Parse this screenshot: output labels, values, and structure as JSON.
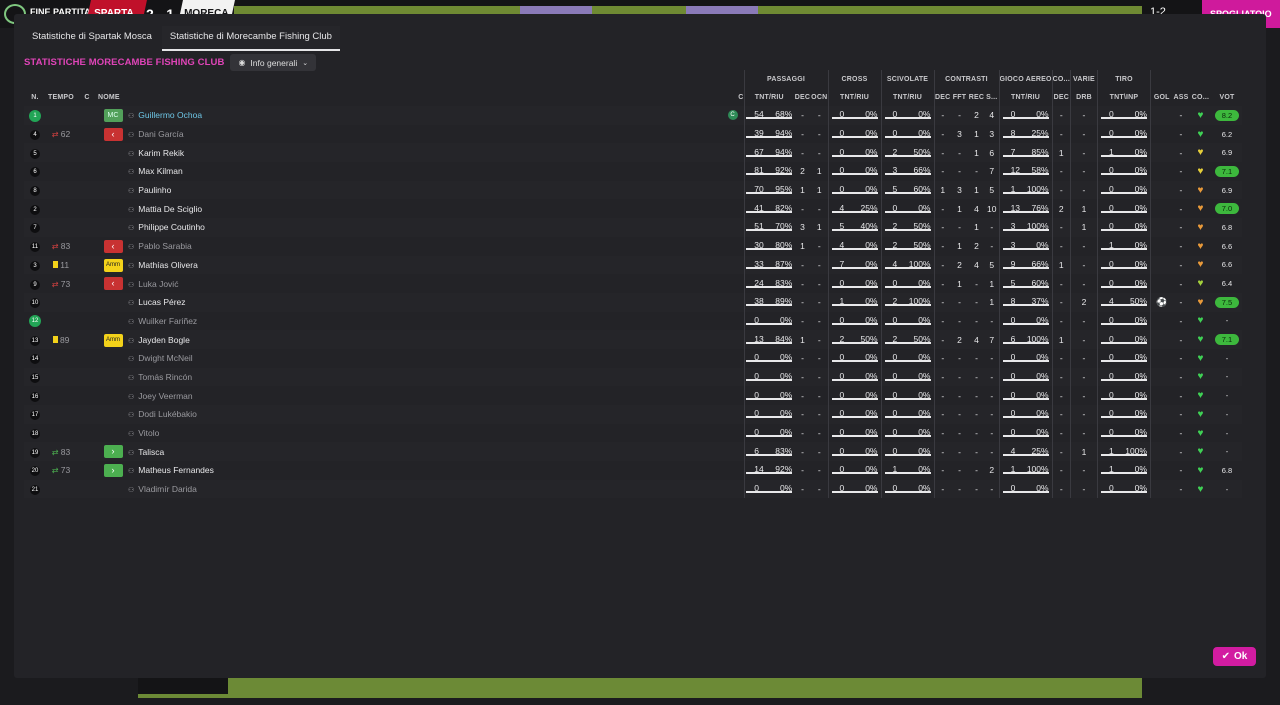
{
  "background": {
    "control": "FINE PARTITA",
    "teamA": "SPARTA",
    "score": "2 - 1",
    "teamB": "MORECA",
    "score2": "1-2",
    "pink_label": "SPOGLIATOIO"
  },
  "tabs": [
    {
      "label": "Statistiche di Spartak Mosca",
      "active": false
    },
    {
      "label": "Statistiche di Morecambe Fishing Club",
      "active": true
    }
  ],
  "club_title": "STATISTICHE MORECAMBE FISHING CLUB",
  "dropdown": {
    "label": "Info generali",
    "icon": "eye-icon"
  },
  "ok_label": "Ok",
  "groups": [
    "PASSAGGI",
    "CROSS",
    "SCIVOLATE",
    "CONTRASTI",
    "GIOCO AEREO",
    "CO...",
    "VARIE",
    "TIRO"
  ],
  "columns": [
    "N.",
    "TEMPO",
    "C",
    "NOME",
    "C",
    "TNT/RIU",
    "DEC",
    "OCN",
    "TNT/RIU",
    "TNT/RIU",
    "DEC",
    "FFT",
    "REC",
    "S...",
    "TNT/RIU",
    "DEC",
    "DRB",
    "TNT\\INP",
    "GOL",
    "ASS",
    "CO...",
    "VOT"
  ],
  "colors": {
    "accent": "#d21ca1",
    "title": "#e044b8",
    "highlight": "#6ec6e6"
  },
  "players": [
    {
      "n": "1",
      "tempo_icon": "",
      "tempo": "",
      "pos": "MC",
      "pos_type": "mc",
      "name": "Guillermo Ochoa",
      "name_style": "hl",
      "cap": "C",
      "pass": [
        "54",
        "68%"
      ],
      "dec": "-",
      "ocn": "-",
      "cross": [
        "0",
        "0%"
      ],
      "scv": [
        "0",
        "0%"
      ],
      "c_dec": "-",
      "fft": "-",
      "rec": "2",
      "s": "4",
      "aer": [
        "0",
        "0%"
      ],
      "co": "-",
      "drb": "-",
      "tiro": [
        "0",
        "0%"
      ],
      "gol": "",
      "ass": "-",
      "heart": "green",
      "vot": "8.2",
      "vot_style": "green",
      "n_green": true
    },
    {
      "n": "4",
      "tempo_icon": "sub",
      "tempo": "62",
      "pos": "‹",
      "pos_type": "sub",
      "name": "Dani García",
      "name_style": "grey",
      "cap": "",
      "pass": [
        "39",
        "94%"
      ],
      "dec": "-",
      "ocn": "-",
      "cross": [
        "0",
        "0%"
      ],
      "scv": [
        "0",
        "0%"
      ],
      "c_dec": "-",
      "fft": "3",
      "rec": "1",
      "s": "3",
      "aer": [
        "8",
        "25%"
      ],
      "co": "-",
      "drb": "-",
      "tiro": [
        "0",
        "0%"
      ],
      "gol": "",
      "ass": "-",
      "heart": "green",
      "vot": "6.2",
      "vot_style": "none"
    },
    {
      "n": "5",
      "tempo_icon": "",
      "tempo": "",
      "pos": "",
      "pos_type": "",
      "name": "Karim Rekik",
      "name_style": "",
      "cap": "",
      "pass": [
        "67",
        "94%"
      ],
      "dec": "-",
      "ocn": "-",
      "cross": [
        "0",
        "0%"
      ],
      "scv": [
        "2",
        "50%"
      ],
      "c_dec": "-",
      "fft": "-",
      "rec": "1",
      "s": "6",
      "aer": [
        "7",
        "85%"
      ],
      "co": "1",
      "drb": "-",
      "tiro": [
        "1",
        "0%"
      ],
      "gol": "",
      "ass": "-",
      "heart": "yellow",
      "vot": "6.9",
      "vot_style": "none"
    },
    {
      "n": "6",
      "tempo_icon": "",
      "tempo": "",
      "pos": "",
      "pos_type": "",
      "name": "Max Kilman",
      "name_style": "",
      "cap": "",
      "pass": [
        "81",
        "92%"
      ],
      "dec": "2",
      "ocn": "1",
      "cross": [
        "0",
        "0%"
      ],
      "scv": [
        "3",
        "66%"
      ],
      "c_dec": "-",
      "fft": "-",
      "rec": "-",
      "s": "7",
      "aer": [
        "12",
        "58%"
      ],
      "co": "-",
      "drb": "-",
      "tiro": [
        "0",
        "0%"
      ],
      "gol": "",
      "ass": "-",
      "heart": "yellow",
      "vot": "7.1",
      "vot_style": "green"
    },
    {
      "n": "8",
      "tempo_icon": "",
      "tempo": "",
      "pos": "",
      "pos_type": "",
      "name": "Paulinho",
      "name_style": "",
      "cap": "",
      "pass": [
        "70",
        "95%"
      ],
      "dec": "1",
      "ocn": "1",
      "cross": [
        "0",
        "0%"
      ],
      "scv": [
        "5",
        "60%"
      ],
      "c_dec": "1",
      "fft": "3",
      "rec": "1",
      "s": "5",
      "aer": [
        "1",
        "100%"
      ],
      "co": "-",
      "drb": "-",
      "tiro": [
        "0",
        "0%"
      ],
      "gol": "",
      "ass": "-",
      "heart": "orange",
      "vot": "6.9",
      "vot_style": "none"
    },
    {
      "n": "2",
      "tempo_icon": "",
      "tempo": "",
      "pos": "",
      "pos_type": "",
      "name": "Mattia De Sciglio",
      "name_style": "",
      "cap": "",
      "pass": [
        "41",
        "82%"
      ],
      "dec": "-",
      "ocn": "-",
      "cross": [
        "4",
        "25%"
      ],
      "scv": [
        "0",
        "0%"
      ],
      "c_dec": "-",
      "fft": "1",
      "rec": "4",
      "s": "10",
      "aer": [
        "13",
        "76%"
      ],
      "co": "2",
      "drb": "1",
      "tiro": [
        "0",
        "0%"
      ],
      "gol": "",
      "ass": "-",
      "heart": "orange",
      "vot": "7.0",
      "vot_style": "green"
    },
    {
      "n": "7",
      "tempo_icon": "",
      "tempo": "",
      "pos": "",
      "pos_type": "",
      "name": "Philippe Coutinho",
      "name_style": "",
      "cap": "",
      "pass": [
        "51",
        "70%"
      ],
      "dec": "3",
      "ocn": "1",
      "cross": [
        "5",
        "40%"
      ],
      "scv": [
        "2",
        "50%"
      ],
      "c_dec": "-",
      "fft": "-",
      "rec": "1",
      "s": "-",
      "aer": [
        "3",
        "100%"
      ],
      "co": "-",
      "drb": "1",
      "tiro": [
        "0",
        "0%"
      ],
      "gol": "",
      "ass": "-",
      "heart": "orange",
      "vot": "6.8",
      "vot_style": "none"
    },
    {
      "n": "11",
      "tempo_icon": "sub",
      "tempo": "83",
      "pos": "‹",
      "pos_type": "sub",
      "name": "Pablo Sarabia",
      "name_style": "grey",
      "cap": "",
      "pass": [
        "30",
        "80%"
      ],
      "dec": "1",
      "ocn": "-",
      "cross": [
        "4",
        "0%"
      ],
      "scv": [
        "2",
        "50%"
      ],
      "c_dec": "-",
      "fft": "1",
      "rec": "2",
      "s": "-",
      "aer": [
        "3",
        "0%"
      ],
      "co": "-",
      "drb": "-",
      "tiro": [
        "1",
        "0%"
      ],
      "gol": "",
      "ass": "-",
      "heart": "orange",
      "vot": "6.6",
      "vot_style": "none"
    },
    {
      "n": "3",
      "tempo_icon": "yellow",
      "tempo": "11",
      "pos": "Amm",
      "pos_type": "amm",
      "name": "Mathías Olivera",
      "name_style": "",
      "cap": "",
      "pass": [
        "33",
        "87%"
      ],
      "dec": "-",
      "ocn": "-",
      "cross": [
        "7",
        "0%"
      ],
      "scv": [
        "4",
        "100%"
      ],
      "c_dec": "-",
      "fft": "2",
      "rec": "4",
      "s": "5",
      "aer": [
        "9",
        "66%"
      ],
      "co": "1",
      "drb": "-",
      "tiro": [
        "0",
        "0%"
      ],
      "gol": "",
      "ass": "-",
      "heart": "orange",
      "vot": "6.6",
      "vot_style": "none"
    },
    {
      "n": "9",
      "tempo_icon": "sub",
      "tempo": "73",
      "pos": "‹",
      "pos_type": "sub",
      "name": "Luka Jović",
      "name_style": "grey",
      "cap": "",
      "pass": [
        "24",
        "83%"
      ],
      "dec": "-",
      "ocn": "-",
      "cross": [
        "0",
        "0%"
      ],
      "scv": [
        "0",
        "0%"
      ],
      "c_dec": "-",
      "fft": "1",
      "rec": "-",
      "s": "1",
      "aer": [
        "5",
        "60%"
      ],
      "co": "-",
      "drb": "-",
      "tiro": [
        "0",
        "0%"
      ],
      "gol": "",
      "ass": "-",
      "heart": "yellowgreen",
      "vot": "6.4",
      "vot_style": "none"
    },
    {
      "n": "10",
      "tempo_icon": "",
      "tempo": "",
      "pos": "",
      "pos_type": "",
      "name": "Lucas Pérez",
      "name_style": "",
      "cap": "",
      "pass": [
        "38",
        "89%"
      ],
      "dec": "-",
      "ocn": "-",
      "cross": [
        "1",
        "0%"
      ],
      "scv": [
        "2",
        "100%"
      ],
      "c_dec": "-",
      "fft": "-",
      "rec": "-",
      "s": "1",
      "aer": [
        "8",
        "37%"
      ],
      "co": "-",
      "drb": "2",
      "tiro": [
        "4",
        "50%"
      ],
      "gol": "ball",
      "ass": "-",
      "heart": "orange",
      "vot": "7.5",
      "vot_style": "green"
    },
    {
      "n": "12",
      "tempo_icon": "",
      "tempo": "",
      "pos": "",
      "pos_type": "",
      "name": "Wuilker Fariñez",
      "name_style": "grey",
      "cap": "",
      "pass": [
        "0",
        "0%"
      ],
      "dec": "-",
      "ocn": "-",
      "cross": [
        "0",
        "0%"
      ],
      "scv": [
        "0",
        "0%"
      ],
      "c_dec": "-",
      "fft": "-",
      "rec": "-",
      "s": "-",
      "aer": [
        "0",
        "0%"
      ],
      "co": "-",
      "drb": "-",
      "tiro": [
        "0",
        "0%"
      ],
      "gol": "",
      "ass": "-",
      "heart": "green",
      "vot": "-",
      "vot_style": "none",
      "n_green": true
    },
    {
      "n": "13",
      "tempo_icon": "yellow",
      "tempo": "89",
      "pos": "Amm",
      "pos_type": "amm",
      "name": "Jayden Bogle",
      "name_style": "",
      "cap": "",
      "pass": [
        "13",
        "84%"
      ],
      "dec": "1",
      "ocn": "-",
      "cross": [
        "2",
        "50%"
      ],
      "scv": [
        "2",
        "50%"
      ],
      "c_dec": "-",
      "fft": "2",
      "rec": "4",
      "s": "7",
      "aer": [
        "6",
        "100%"
      ],
      "co": "1",
      "drb": "-",
      "tiro": [
        "0",
        "0%"
      ],
      "gol": "",
      "ass": "-",
      "heart": "green",
      "vot": "7.1",
      "vot_style": "green"
    },
    {
      "n": "14",
      "tempo_icon": "",
      "tempo": "",
      "pos": "",
      "pos_type": "",
      "name": "Dwight McNeil",
      "name_style": "grey",
      "cap": "",
      "pass": [
        "0",
        "0%"
      ],
      "dec": "-",
      "ocn": "-",
      "cross": [
        "0",
        "0%"
      ],
      "scv": [
        "0",
        "0%"
      ],
      "c_dec": "-",
      "fft": "-",
      "rec": "-",
      "s": "-",
      "aer": [
        "0",
        "0%"
      ],
      "co": "-",
      "drb": "-",
      "tiro": [
        "0",
        "0%"
      ],
      "gol": "",
      "ass": "-",
      "heart": "green",
      "vot": "-",
      "vot_style": "none"
    },
    {
      "n": "15",
      "tempo_icon": "",
      "tempo": "",
      "pos": "",
      "pos_type": "",
      "name": "Tomás Rincón",
      "name_style": "grey",
      "cap": "",
      "pass": [
        "0",
        "0%"
      ],
      "dec": "-",
      "ocn": "-",
      "cross": [
        "0",
        "0%"
      ],
      "scv": [
        "0",
        "0%"
      ],
      "c_dec": "-",
      "fft": "-",
      "rec": "-",
      "s": "-",
      "aer": [
        "0",
        "0%"
      ],
      "co": "-",
      "drb": "-",
      "tiro": [
        "0",
        "0%"
      ],
      "gol": "",
      "ass": "-",
      "heart": "green",
      "vot": "-",
      "vot_style": "none"
    },
    {
      "n": "16",
      "tempo_icon": "",
      "tempo": "",
      "pos": "",
      "pos_type": "",
      "name": "Joey Veerman",
      "name_style": "grey",
      "cap": "",
      "pass": [
        "0",
        "0%"
      ],
      "dec": "-",
      "ocn": "-",
      "cross": [
        "0",
        "0%"
      ],
      "scv": [
        "0",
        "0%"
      ],
      "c_dec": "-",
      "fft": "-",
      "rec": "-",
      "s": "-",
      "aer": [
        "0",
        "0%"
      ],
      "co": "-",
      "drb": "-",
      "tiro": [
        "0",
        "0%"
      ],
      "gol": "",
      "ass": "-",
      "heart": "green",
      "vot": "-",
      "vot_style": "none"
    },
    {
      "n": "17",
      "tempo_icon": "",
      "tempo": "",
      "pos": "",
      "pos_type": "",
      "name": "Dodi Lukébakio",
      "name_style": "grey",
      "cap": "",
      "pass": [
        "0",
        "0%"
      ],
      "dec": "-",
      "ocn": "-",
      "cross": [
        "0",
        "0%"
      ],
      "scv": [
        "0",
        "0%"
      ],
      "c_dec": "-",
      "fft": "-",
      "rec": "-",
      "s": "-",
      "aer": [
        "0",
        "0%"
      ],
      "co": "-",
      "drb": "-",
      "tiro": [
        "0",
        "0%"
      ],
      "gol": "",
      "ass": "-",
      "heart": "green",
      "vot": "-",
      "vot_style": "none"
    },
    {
      "n": "18",
      "tempo_icon": "",
      "tempo": "",
      "pos": "",
      "pos_type": "",
      "name": "Vitolo",
      "name_style": "grey",
      "cap": "",
      "pass": [
        "0",
        "0%"
      ],
      "dec": "-",
      "ocn": "-",
      "cross": [
        "0",
        "0%"
      ],
      "scv": [
        "0",
        "0%"
      ],
      "c_dec": "-",
      "fft": "-",
      "rec": "-",
      "s": "-",
      "aer": [
        "0",
        "0%"
      ],
      "co": "-",
      "drb": "-",
      "tiro": [
        "0",
        "0%"
      ],
      "gol": "",
      "ass": "-",
      "heart": "green",
      "vot": "-",
      "vot_style": "none"
    },
    {
      "n": "19",
      "tempo_icon": "in",
      "tempo": "83",
      "pos": "›",
      "pos_type": "in",
      "name": "Talisca",
      "name_style": "",
      "cap": "",
      "pass": [
        "6",
        "83%"
      ],
      "dec": "-",
      "ocn": "-",
      "cross": [
        "0",
        "0%"
      ],
      "scv": [
        "0",
        "0%"
      ],
      "c_dec": "-",
      "fft": "-",
      "rec": "-",
      "s": "-",
      "aer": [
        "4",
        "25%"
      ],
      "co": "-",
      "drb": "1",
      "tiro": [
        "1",
        "100%"
      ],
      "gol": "",
      "ass": "-",
      "heart": "green",
      "vot": "-",
      "vot_style": "none"
    },
    {
      "n": "20",
      "tempo_icon": "in",
      "tempo": "73",
      "pos": "›",
      "pos_type": "in",
      "name": "Matheus Fernandes",
      "name_style": "",
      "cap": "",
      "pass": [
        "14",
        "92%"
      ],
      "dec": "-",
      "ocn": "-",
      "cross": [
        "0",
        "0%"
      ],
      "scv": [
        "1",
        "0%"
      ],
      "c_dec": "-",
      "fft": "-",
      "rec": "-",
      "s": "2",
      "aer": [
        "1",
        "100%"
      ],
      "co": "-",
      "drb": "-",
      "tiro": [
        "1",
        "0%"
      ],
      "gol": "",
      "ass": "-",
      "heart": "green",
      "vot": "6.8",
      "vot_style": "none"
    },
    {
      "n": "21",
      "tempo_icon": "",
      "tempo": "",
      "pos": "",
      "pos_type": "",
      "name": "Vladimír Darida",
      "name_style": "grey",
      "cap": "",
      "pass": [
        "0",
        "0%"
      ],
      "dec": "-",
      "ocn": "-",
      "cross": [
        "0",
        "0%"
      ],
      "scv": [
        "0",
        "0%"
      ],
      "c_dec": "-",
      "fft": "-",
      "rec": "-",
      "s": "-",
      "aer": [
        "0",
        "0%"
      ],
      "co": "-",
      "drb": "-",
      "tiro": [
        "0",
        "0%"
      ],
      "gol": "",
      "ass": "-",
      "heart": "green",
      "vot": "-",
      "vot_style": "none"
    }
  ]
}
